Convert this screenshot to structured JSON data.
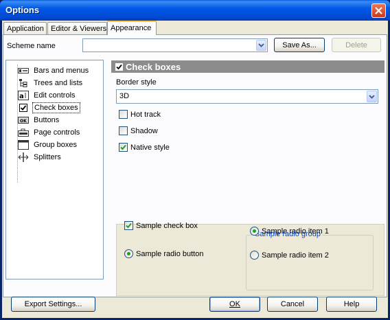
{
  "window": {
    "title": "Options"
  },
  "tabs": [
    {
      "label": "Application"
    },
    {
      "label": "Editor & Viewers"
    },
    {
      "label": "Appearance"
    }
  ],
  "scheme": {
    "label": "Scheme name",
    "value": "",
    "save_as_label": "Save As...",
    "delete_label": "Delete"
  },
  "tree": {
    "items": [
      {
        "label": "Bars and menus",
        "icon": "bars-and-menus-icon"
      },
      {
        "label": "Trees and lists",
        "icon": "tree-icon"
      },
      {
        "label": "Edit controls",
        "icon": "edit-control-icon"
      },
      {
        "label": "Check boxes",
        "icon": "checkbox-icon"
      },
      {
        "label": "Buttons",
        "icon": "button-icon"
      },
      {
        "label": "Page controls",
        "icon": "page-control-icon"
      },
      {
        "label": "Group boxes",
        "icon": "group-box-icon"
      },
      {
        "label": "Splitters",
        "icon": "splitter-icon"
      }
    ],
    "selected_index": 3
  },
  "section": {
    "title": "Check boxes",
    "checked": true
  },
  "border_style": {
    "label": "Border style",
    "value": "3D"
  },
  "options": [
    {
      "label": "Hot track",
      "checked": false
    },
    {
      "label": "Shadow",
      "checked": false
    },
    {
      "label": "Native style",
      "checked": true
    }
  ],
  "sample": {
    "check_box_label": "Sample check box",
    "check_box_checked": true,
    "radio_button_label": "Sample radio button",
    "radio_button_selected": true,
    "radio_group": {
      "title": "Sample radio group",
      "items": [
        {
          "label": "Sample radio item 1",
          "selected": true
        },
        {
          "label": "Sample radio item 2",
          "selected": false
        }
      ]
    }
  },
  "footer": {
    "export_label": "Export Settings...",
    "ok_label": "OK",
    "cancel_label": "Cancel",
    "help_label": "Help"
  },
  "colors": {
    "title_bar": "#0054e3",
    "header_bar": "#8c8c8c",
    "group_title": "#0046d5",
    "check_mark": "#21a121"
  }
}
